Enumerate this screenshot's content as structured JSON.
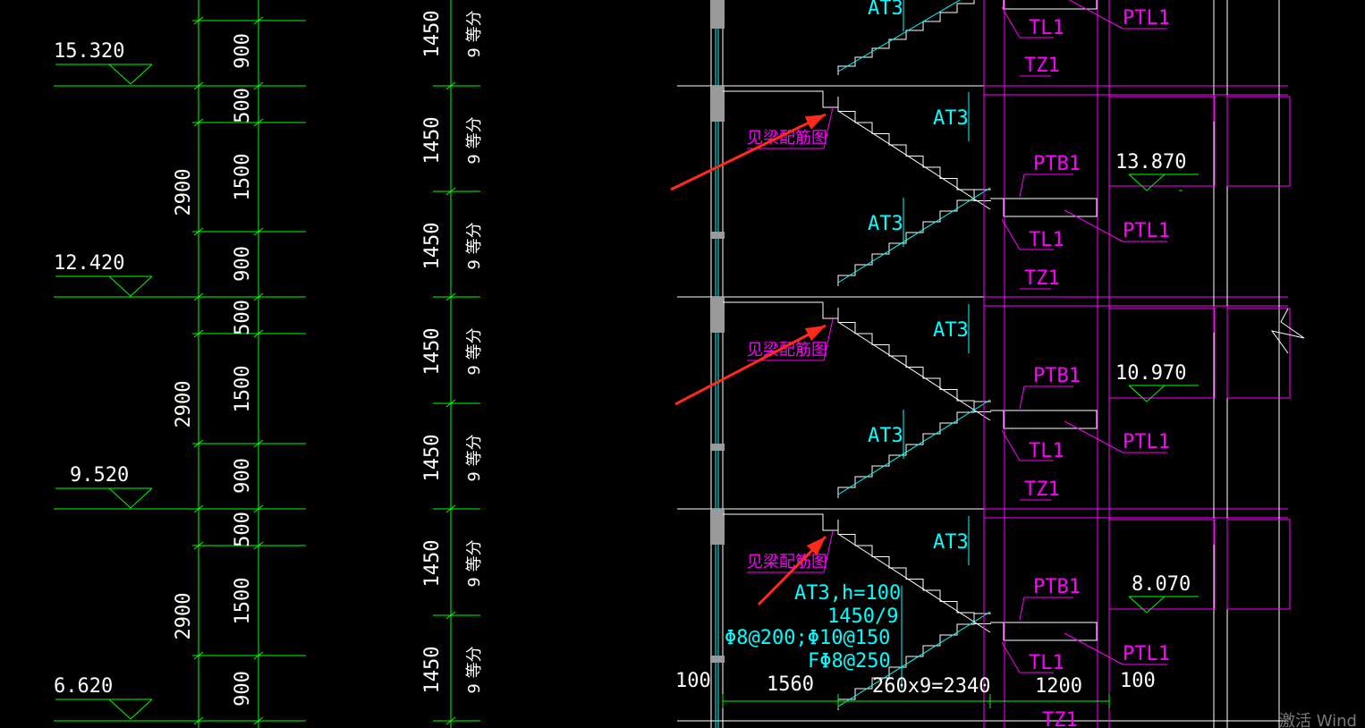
{
  "colors": {
    "background": "#000000",
    "dim_green": "#00ff00",
    "structure_white": "#ffffff",
    "cyan": "#00ffff",
    "magenta": "#ff00ff",
    "arrow_red": "#ff2a1a",
    "column_grey": "#9a9a9a"
  },
  "elevations": [
    "15.320",
    "12.420",
    "9.520",
    "6.620"
  ],
  "left_dims": {
    "storey": "2900",
    "segments": [
      "900",
      "500",
      "1500"
    ]
  },
  "mid_dims": {
    "value": "1450",
    "count": "9 等分"
  },
  "stair_labels": {
    "flight": "AT3",
    "platform_slab": "PTB1",
    "platform_beam": "PTL1",
    "beam": "TL1",
    "column": "TZ1",
    "see_beam_rebar": "见梁配筋图"
  },
  "right_elevations": [
    "13.870",
    "10.970",
    "8.070"
  ],
  "flight_note": {
    "line1": "AT3,h=100",
    "line2": "1450/9",
    "line3": "Φ8@200;Φ10@150",
    "line4": "FΦ8@250"
  },
  "bottom_dims": [
    "100",
    "1560",
    "260x9=2340",
    "1200",
    "100"
  ],
  "watermark": "激活 Wind"
}
